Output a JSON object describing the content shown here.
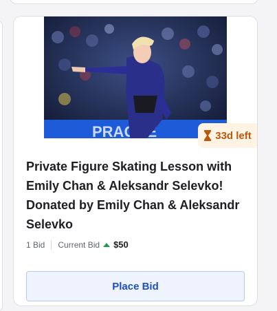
{
  "listing": {
    "time_left": "33d left",
    "title": "Private Figure Skating Lesson with Emily Chan & Aleksandr Selevko! Donated by Emily Chan & Aleksandr Selevko",
    "bid_count": "1 Bid",
    "current_bid_label": "Current Bid",
    "current_bid_value": "$50",
    "place_bid_label": "Place Bid",
    "photo_icon": "figure-skater-photo",
    "favorite_icon": "heart-icon",
    "timer_icon": "hourglass-icon",
    "bid_trend_icon": "arrow-up-icon"
  },
  "colors": {
    "badge_bg": "#fff3e3",
    "badge_text": "#b9590f",
    "button_bg": "#eef3fd",
    "button_text": "#1d4fbf",
    "trend_up": "#1e9a4b"
  }
}
